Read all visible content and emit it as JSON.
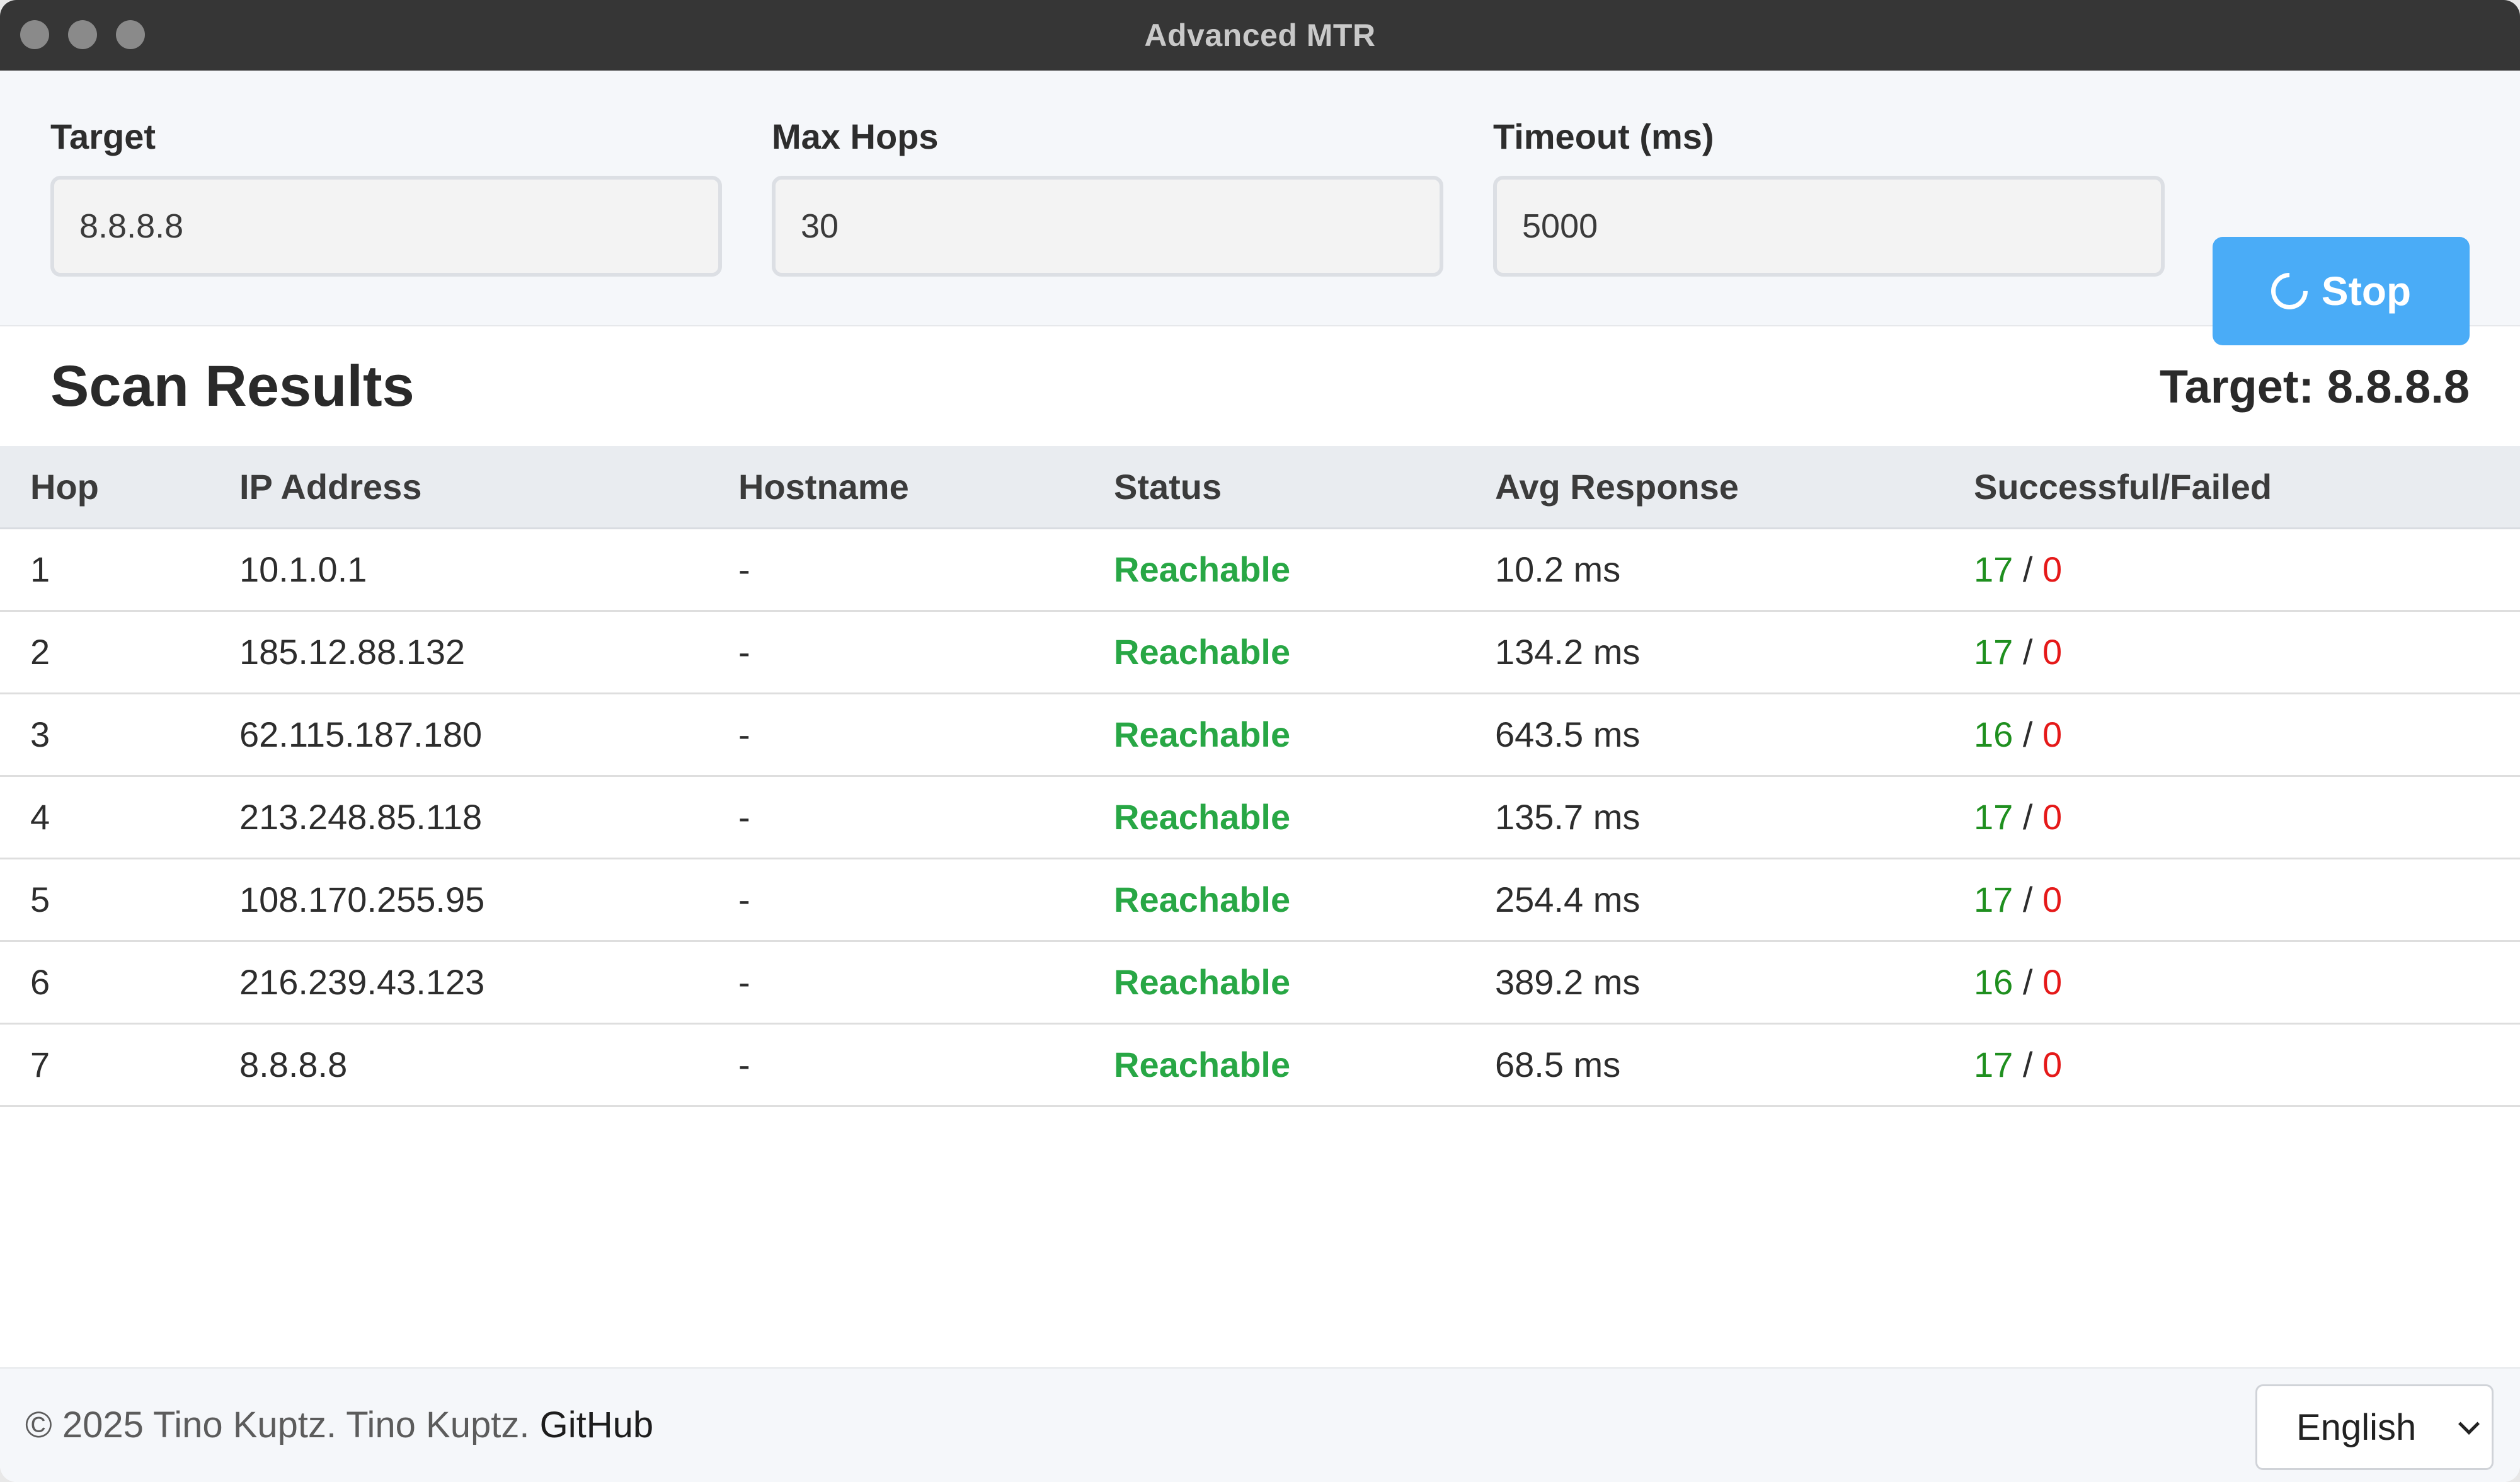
{
  "window": {
    "title": "Advanced MTR"
  },
  "controls": {
    "target": {
      "label": "Target",
      "value": "8.8.8.8"
    },
    "max_hops": {
      "label": "Max Hops",
      "value": "30"
    },
    "timeout": {
      "label": "Timeout (ms)",
      "value": "5000"
    },
    "stop_label": "Stop"
  },
  "results": {
    "title": "Scan Results",
    "target_text": "Target: 8.8.8.8",
    "columns": [
      "Hop",
      "IP Address",
      "Hostname",
      "Status",
      "Avg Response",
      "Successful/Failed"
    ],
    "rows": [
      {
        "hop": "1",
        "ip": "10.1.0.1",
        "hostname": "-",
        "status": "Reachable",
        "avg": "10.2 ms",
        "successful": "17",
        "failed": "0"
      },
      {
        "hop": "2",
        "ip": "185.12.88.132",
        "hostname": "-",
        "status": "Reachable",
        "avg": "134.2 ms",
        "successful": "17",
        "failed": "0"
      },
      {
        "hop": "3",
        "ip": "62.115.187.180",
        "hostname": "-",
        "status": "Reachable",
        "avg": "643.5 ms",
        "successful": "16",
        "failed": "0"
      },
      {
        "hop": "4",
        "ip": "213.248.85.118",
        "hostname": "-",
        "status": "Reachable",
        "avg": "135.7 ms",
        "successful": "17",
        "failed": "0"
      },
      {
        "hop": "5",
        "ip": "108.170.255.95",
        "hostname": "-",
        "status": "Reachable",
        "avg": "254.4 ms",
        "successful": "17",
        "failed": "0"
      },
      {
        "hop": "6",
        "ip": "216.239.43.123",
        "hostname": "-",
        "status": "Reachable",
        "avg": "389.2 ms",
        "successful": "16",
        "failed": "0"
      },
      {
        "hop": "7",
        "ip": "8.8.8.8",
        "hostname": "-",
        "status": "Reachable",
        "avg": "68.5 ms",
        "successful": "17",
        "failed": "0"
      }
    ]
  },
  "footer": {
    "copyright": "© 2025 Tino Kuptz. Tino Kuptz.",
    "github_label": "GitHub",
    "language": "English"
  },
  "colors": {
    "accent": "#4aacf7",
    "status_ok": "#28a745",
    "success": "#1f8f1f",
    "failed": "#e51919",
    "titlebar": "#363636"
  },
  "icons": {
    "stop_button": "spinner-icon",
    "language_select": "chevron-down-icon"
  }
}
